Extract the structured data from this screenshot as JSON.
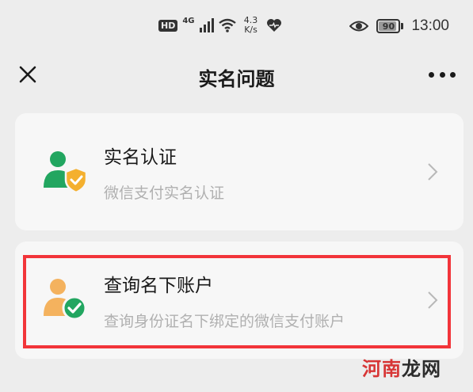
{
  "status_bar": {
    "hd_badge": "HD",
    "network_type": "4G",
    "speed_value": "4.3",
    "speed_unit": "K/s",
    "battery_level": "90",
    "time": "13:00"
  },
  "nav": {
    "title": "实名问题"
  },
  "cards": [
    {
      "title": "实名认证",
      "subtitle": "微信支付实名认证",
      "icon": "person-shield-icon",
      "icon_colors": {
        "person": "#22a660",
        "shield": "#f4b02f"
      }
    },
    {
      "title": "查询名下账户",
      "subtitle": "查询身份证名下绑定的微信支付账户",
      "icon": "person-check-icon",
      "icon_colors": {
        "person": "#f4b25e",
        "badge": "#22a660"
      }
    }
  ],
  "highlight_color": "#f2353a",
  "watermark": {
    "part1": "河南",
    "part2": "龙网"
  }
}
